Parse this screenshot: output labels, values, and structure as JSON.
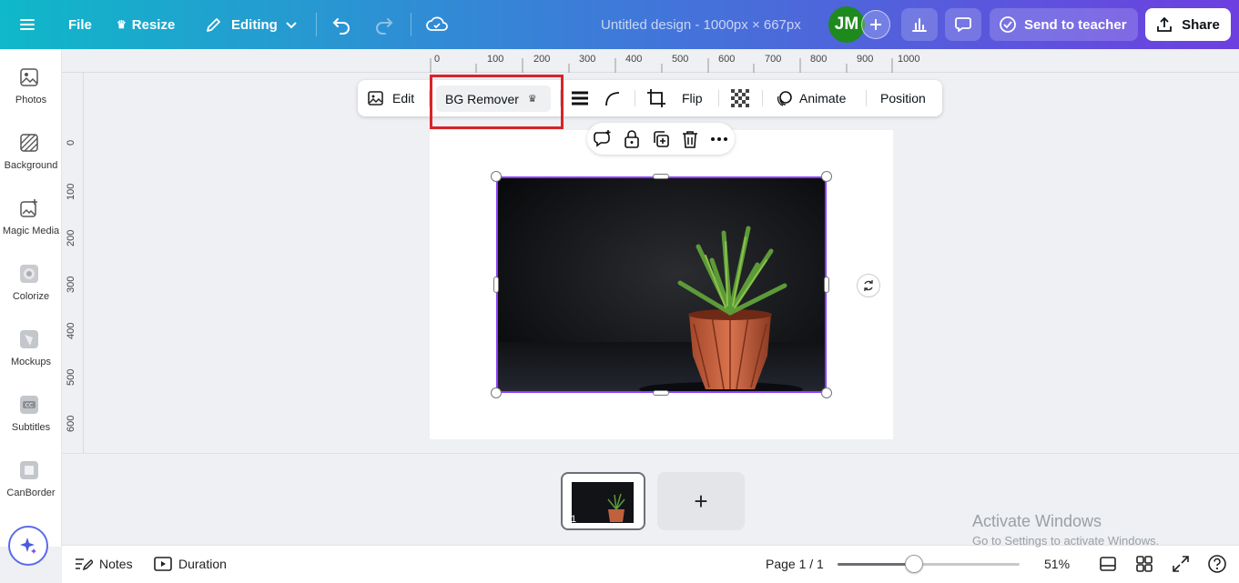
{
  "topbar": {
    "menu_icon": "hamburger-icon",
    "file": "File",
    "resize": "Resize",
    "editing": "Editing",
    "title": "Untitled design - 1000px × 667px",
    "avatar": "JM",
    "send_to_teacher": "Send to teacher",
    "share": "Share",
    "colors": {
      "gradient_start": "#0fb8c9",
      "gradient_end": "#6d3fe0",
      "avatar": "#1e8a1e"
    }
  },
  "sidebar": {
    "items": [
      {
        "label": "Photos",
        "icon": "photo-icon"
      },
      {
        "label": "Background",
        "icon": "background-icon"
      },
      {
        "label": "Magic Media",
        "icon": "magic-media-icon"
      },
      {
        "label": "Colorize",
        "icon": "colorize-icon"
      },
      {
        "label": "Mockups",
        "icon": "mockups-icon"
      },
      {
        "label": "Subtitles",
        "icon": "subtitles-icon"
      },
      {
        "label": "CanBorder",
        "icon": "canborder-icon"
      }
    ]
  },
  "ruler": {
    "top": [
      "0",
      "100",
      "200",
      "300",
      "400",
      "500",
      "600",
      "700",
      "800",
      "900",
      "1000"
    ],
    "left": [
      "0",
      "100",
      "200",
      "300",
      "400",
      "500",
      "600"
    ]
  },
  "toolbar": {
    "edit": "Edit",
    "bg_remover": "BG Remover",
    "flip": "Flip",
    "animate": "Animate",
    "position": "Position"
  },
  "pages": {
    "thumb_number": "1",
    "add": "+"
  },
  "footer": {
    "notes": "Notes",
    "duration": "Duration",
    "page": "Page 1 / 1",
    "zoom": "51%",
    "zoom_level": 0.42
  },
  "watermark": {
    "title": "Activate Windows",
    "subtitle": "Go to Settings to activate Windows."
  }
}
